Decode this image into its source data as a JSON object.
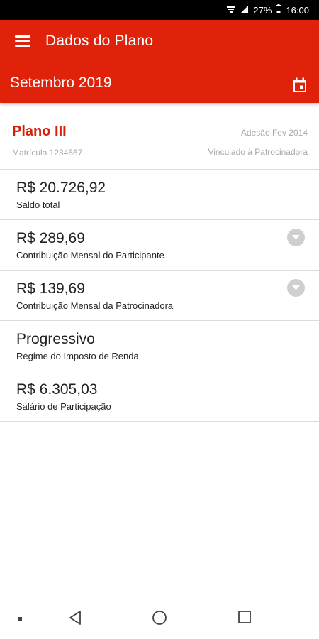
{
  "status_bar": {
    "battery": "27%",
    "time": "16:00"
  },
  "app_bar": {
    "title": "Dados do Plano"
  },
  "month_bar": {
    "label": "Setembro 2019"
  },
  "plan": {
    "name": "Plano III",
    "matricula": "Matrícula 1234567",
    "adesao": "Adesão Fev 2014",
    "vinculo": "Vinculado à Patrocinadora"
  },
  "rows": [
    {
      "value": "R$ 20.726,92",
      "label": "Saldo total",
      "expandable": false
    },
    {
      "value": "R$ 289,69",
      "label": "Contribuição Mensal do Participante",
      "expandable": true
    },
    {
      "value": "R$ 139,69",
      "label": "Contribuição Mensal da Patrocinadora",
      "expandable": true
    },
    {
      "value": "Progressivo",
      "label": "Regime do Imposto de Renda",
      "expandable": false
    },
    {
      "value": "R$ 6.305,03",
      "label": "Salário de Participação",
      "expandable": false
    }
  ],
  "colors": {
    "brand": "#e0220a",
    "plan_name": "#d51f0a",
    "muted_text": "#a8a8a8",
    "expand_button": "#cfcfcf"
  },
  "icons": {
    "menu": "menu-icon",
    "calendar": "calendar-icon",
    "expand": "chevron-down-icon",
    "nav_back": "back-icon",
    "nav_home": "home-icon",
    "nav_recents": "recents-icon"
  }
}
